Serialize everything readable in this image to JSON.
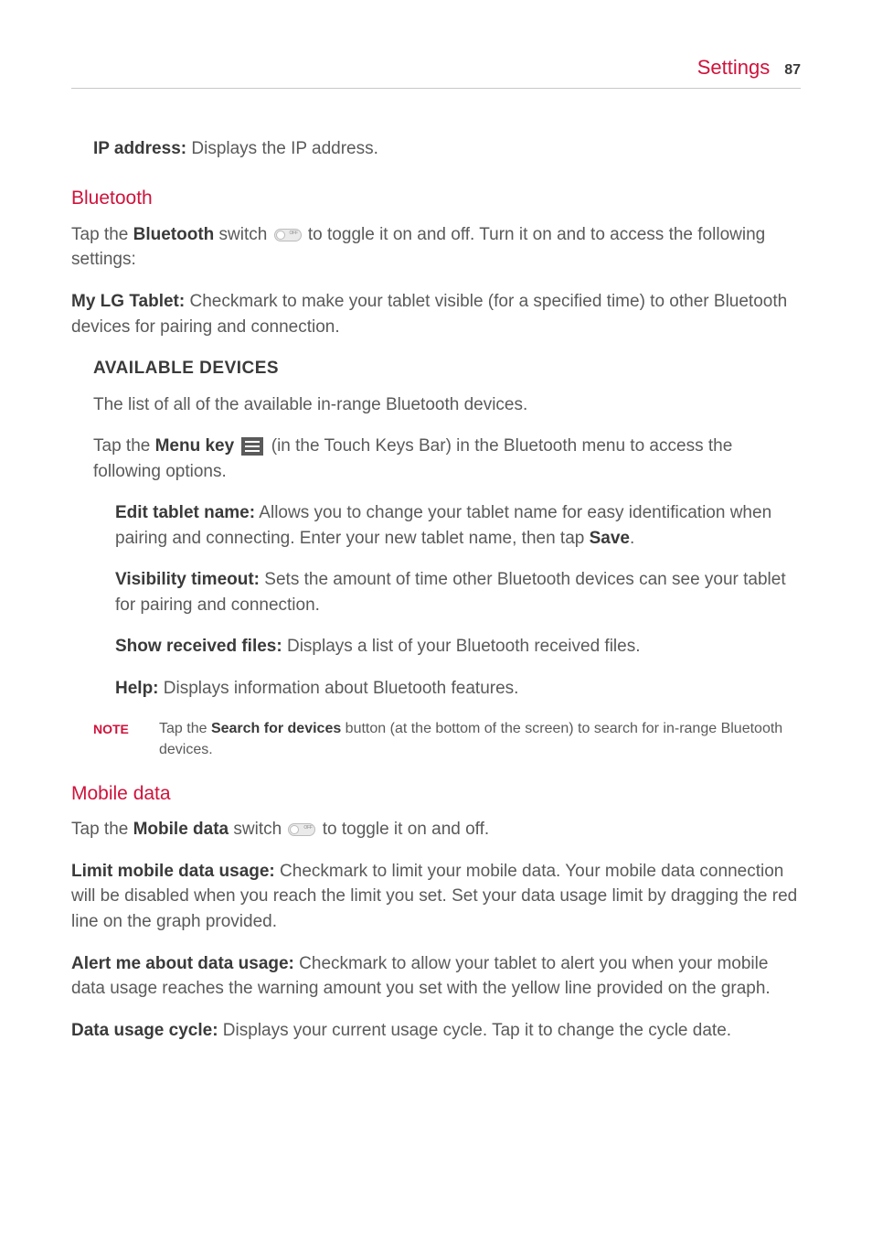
{
  "header": {
    "title": "Settings",
    "page_number": "87"
  },
  "ip_address": {
    "label": "IP address:",
    "desc": " Displays the IP address."
  },
  "bluetooth": {
    "heading": "Bluetooth",
    "intro_pre": "Tap the ",
    "intro_bold": "Bluetooth",
    "intro_mid": " switch ",
    "intro_post": " to toggle it on and off. Turn it on and to access the following settings:",
    "my_tablet_label": "My LG Tablet:",
    "my_tablet_desc": " Checkmark to make your tablet visible (for a specified time) to other Bluetooth devices for pairing and connection.",
    "available_heading": "AVAILABLE DEVICES",
    "available_desc": "The list of all of the available in-range Bluetooth devices.",
    "menu_pre": "Tap the ",
    "menu_bold": "Menu key",
    "menu_mid": " ",
    "menu_post": " (in the Touch Keys Bar) in the Bluetooth menu to access the following options.",
    "edit_label": "Edit tablet name:",
    "edit_desc_pre": " Allows you to change your tablet name for easy identification when pairing and connecting. Enter your new tablet name, then tap ",
    "edit_save": "Save",
    "edit_desc_post": ".",
    "visibility_label": "Visibility timeout:",
    "visibility_desc": " Sets the amount of time other Bluetooth devices can see your tablet for pairing and connection.",
    "show_label": "Show received files:",
    "show_desc": " Displays a list of your Bluetooth received files.",
    "help_label": "Help:",
    "help_desc": " Displays information about Bluetooth features.",
    "note_label": "NOTE",
    "note_pre": "Tap the ",
    "note_bold": "Search for devices",
    "note_post": " button (at the bottom of the screen) to search for in-range Bluetooth devices."
  },
  "mobile_data": {
    "heading": "Mobile data",
    "intro_pre": "Tap the ",
    "intro_bold": "Mobile data",
    "intro_mid": " switch ",
    "intro_post": " to toggle it on and off.",
    "limit_label": "Limit mobile data usage:",
    "limit_desc": " Checkmark to limit your mobile data. Your mobile data connection will be disabled when you reach the limit you set. Set your data usage limit by dragging the red line on the graph provided.",
    "alert_label": "Alert me about data usage:",
    "alert_desc": " Checkmark to allow your tablet to alert you when your mobile data usage reaches the warning amount you set with the yellow line provided on the graph.",
    "cycle_label": "Data usage cycle:",
    "cycle_desc": " Displays your current usage cycle. Tap it to change the cycle date."
  }
}
